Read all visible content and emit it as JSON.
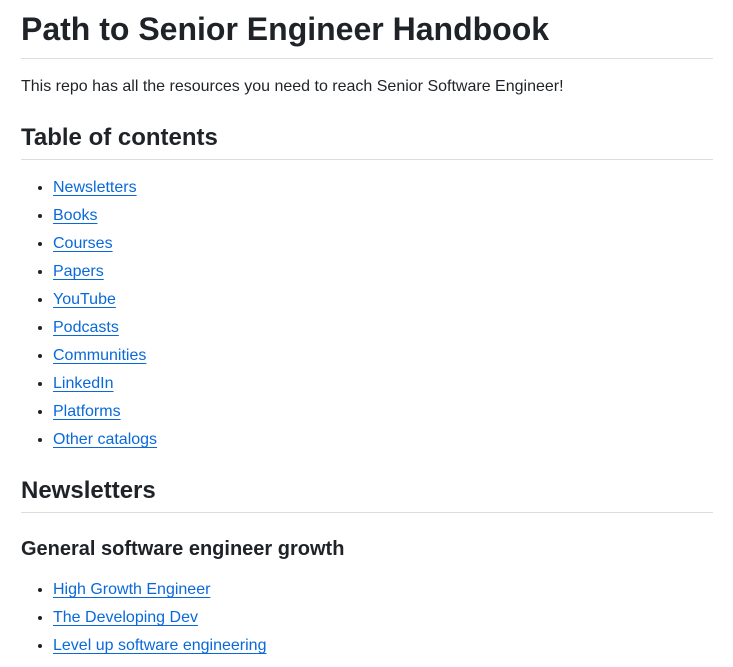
{
  "title": "Path to Senior Engineer Handbook",
  "intro": "This repo has all the resources you need to reach Senior Software Engineer!",
  "toc_heading": "Table of contents",
  "toc": [
    "Newsletters",
    "Books",
    "Courses",
    "Papers",
    "YouTube",
    "Podcasts",
    "Communities",
    "LinkedIn",
    "Platforms",
    "Other catalogs"
  ],
  "newsletters_heading": "Newsletters",
  "growth_heading": "General software engineer growth",
  "growth": [
    "High Growth Engineer",
    "The Developing Dev",
    "Level up software engineering"
  ]
}
